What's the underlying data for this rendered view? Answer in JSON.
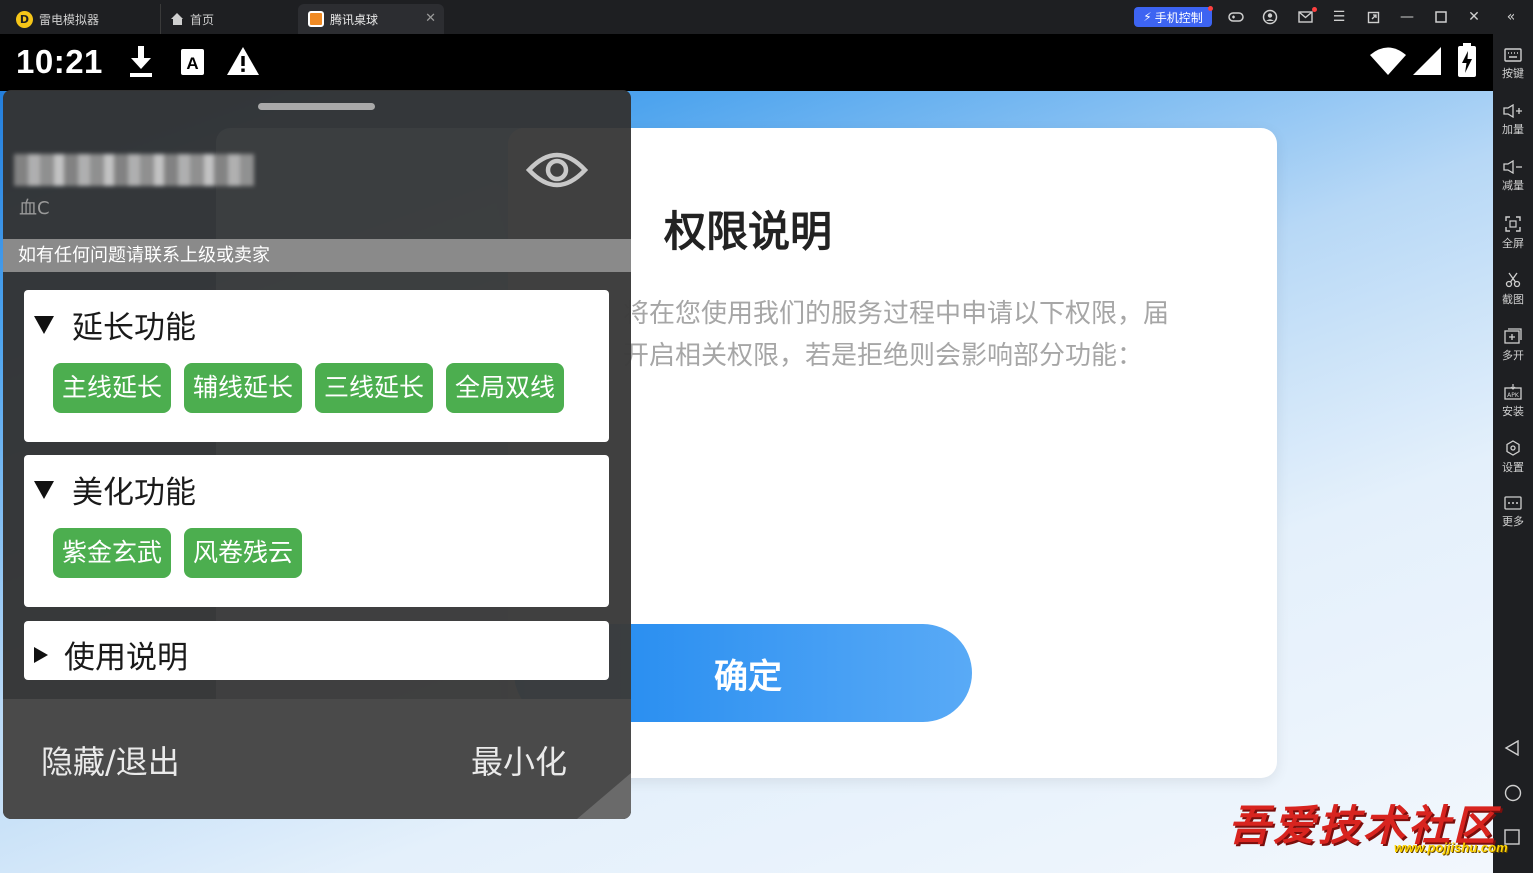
{
  "titlebar": {
    "app_name": "雷电模拟器",
    "tabs": [
      {
        "label": "首页",
        "icon": "home-icon"
      },
      {
        "label": "腾讯桌球",
        "icon": "game-icon"
      }
    ],
    "phone_control": "手机控制",
    "accent": "#3d64f2"
  },
  "statusbar": {
    "time": "10:21",
    "left_icons": [
      "download-icon",
      "font-icon",
      "warning-icon"
    ],
    "right_icons": [
      "wifi-icon",
      "signal-icon",
      "battery-charging-icon"
    ]
  },
  "permission_dialog": {
    "title": "权限说明",
    "body_line1": "将在您使用我们的服务过程中申请以下权限，届",
    "body_line2": "开启相关权限，若是拒绝则会影响部分功能：",
    "confirm": "确定"
  },
  "overlay": {
    "user_subtitle": "血C",
    "notice": "如有任何问题请联系上级或卖家",
    "sections": [
      {
        "title": "延长功能",
        "expanded": true,
        "buttons": [
          "主线延长",
          "辅线延长",
          "三线延长",
          "全局双线"
        ]
      },
      {
        "title": "美化功能",
        "expanded": true,
        "buttons": [
          "紫金玄武",
          "风卷残云"
        ]
      },
      {
        "title": "使用说明",
        "expanded": false,
        "buttons": []
      }
    ],
    "footer": {
      "left": "隐藏/退出",
      "right": "最小化"
    },
    "chip_color": "#4cae4f"
  },
  "sidebar": {
    "items": [
      "按键",
      "加量",
      "减量",
      "全屏",
      "截图",
      "多开",
      "安装",
      "设置",
      "更多"
    ]
  },
  "watermark": {
    "title": "吾爱技术社区",
    "url": "www.pojjishu.com"
  }
}
